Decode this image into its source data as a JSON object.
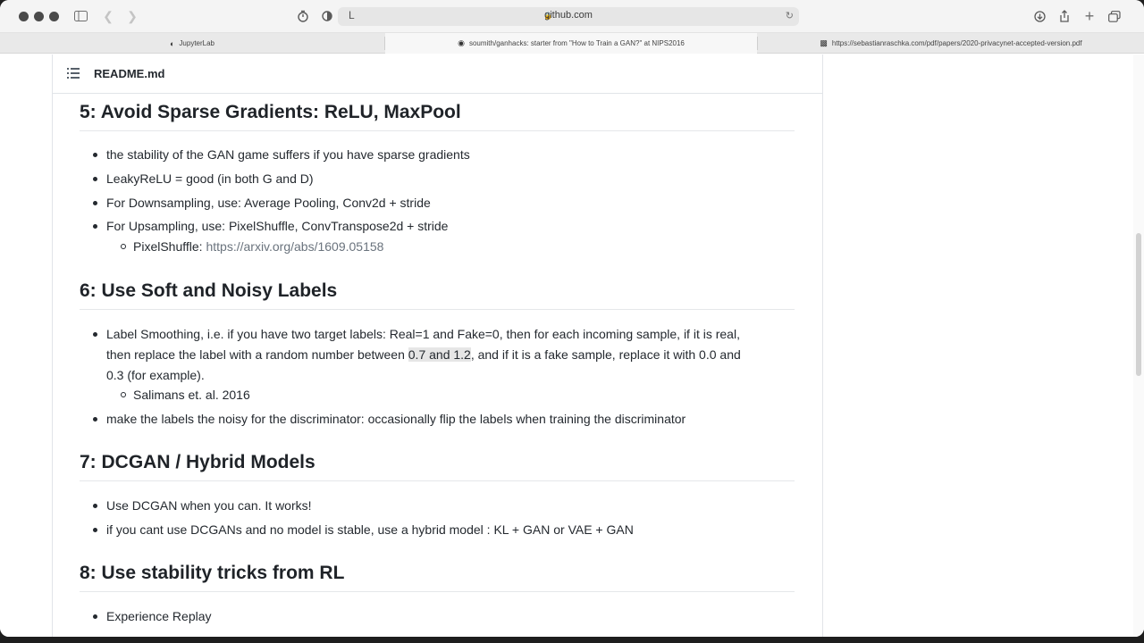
{
  "browser": {
    "url": "github.com",
    "tabs": [
      {
        "label": "JupyterLab",
        "icon": "jupyter-icon"
      },
      {
        "label": "soumith/ganhacks: starter from \"How to Train a GAN?\" at NIPS2016",
        "icon": "github-icon"
      },
      {
        "label": "https://sebastianraschka.com/pdf/papers/2020-privacynet-accepted-version.pdf",
        "icon": "document-icon"
      }
    ]
  },
  "readme": {
    "title": "README.md",
    "sections": [
      {
        "heading": "5: Avoid Sparse Gradients: ReLU, MaxPool",
        "items": [
          "the stability of the GAN game suffers if you have sparse gradients",
          "LeakyReLU = good (in both G and D)",
          "For Downsampling, use: Average Pooling, Conv2d + stride",
          "For Upsampling, use: PixelShuffle, ConvTranspose2d + stride"
        ],
        "sub": {
          "label": "PixelShuffle: ",
          "link": "https://arxiv.org/abs/1609.05158"
        }
      },
      {
        "heading": "6: Use Soft and Noisy Labels",
        "item1_line1": "Label Smoothing, i.e. if you have two target labels: Real=1 and Fake=0, then for each incoming sample, if it is real,",
        "item1_line2_a": "then replace the label with a random number between ",
        "item1_line2_hl": "0.7 and 1.2",
        "item1_line2_b": ", and if it is a fake sample, replace it with 0.0 and",
        "item1_line3": "0.3 (for example).",
        "sub": "Salimans et. al. 2016",
        "item2": "make the labels the noisy for the discriminator: occasionally flip the labels when training the discriminator"
      },
      {
        "heading": "7: DCGAN / Hybrid Models",
        "items": [
          "Use DCGAN when you can. It works!",
          "if you cant use DCGANs and no model is stable, use a hybrid model : KL + GAN or VAE + GAN"
        ]
      },
      {
        "heading": "8: Use stability tricks from RL",
        "items": [
          "Experience Replay"
        ]
      }
    ]
  }
}
